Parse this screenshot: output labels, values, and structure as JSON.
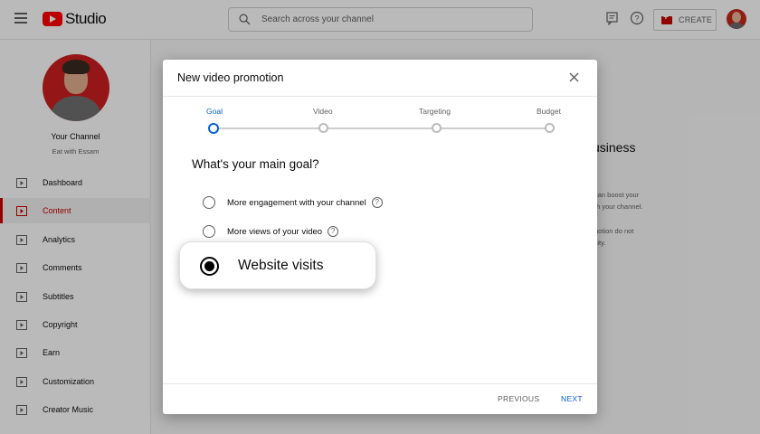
{
  "header": {
    "logo_text": "Studio",
    "search_placeholder": "Search across your channel",
    "create_label": "CREATE"
  },
  "sidebar": {
    "channel_name": "Your Channel",
    "channel_subtitle": "Eat with Essam",
    "items": [
      {
        "label": "Dashboard",
        "active": false
      },
      {
        "label": "Content",
        "active": true
      },
      {
        "label": "Analytics",
        "active": false
      },
      {
        "label": "Comments",
        "active": false
      },
      {
        "label": "Subtitles",
        "active": false
      },
      {
        "label": "Copyright",
        "active": false
      },
      {
        "label": "Earn",
        "active": false
      },
      {
        "label": "Customization",
        "active": false
      },
      {
        "label": "Creator Music",
        "active": false
      }
    ]
  },
  "background": {
    "heading": "usiness",
    "lines": [
      "can boost your",
      "th your channel.",
      "notion do not",
      "ility."
    ]
  },
  "modal": {
    "title": "New video promotion",
    "steps": [
      {
        "label": "Goal",
        "active": true
      },
      {
        "label": "Video",
        "active": false
      },
      {
        "label": "Targeting",
        "active": false
      },
      {
        "label": "Budget",
        "active": false
      }
    ],
    "question": "What's your main goal?",
    "options": [
      {
        "label": "More engagement with your channel",
        "selected": false,
        "help": "?"
      },
      {
        "label": "More views of your video",
        "selected": false,
        "help": "?"
      },
      {
        "label": "Website visits",
        "selected": true
      }
    ],
    "previous_label": "PREVIOUS",
    "next_label": "NEXT"
  },
  "colors": {
    "accent_blue": "#065fd4",
    "brand_red": "#ff0000",
    "active_red": "#cc0000"
  }
}
